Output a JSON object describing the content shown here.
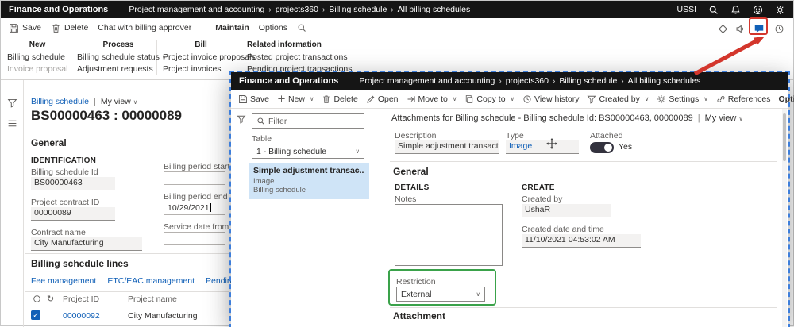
{
  "colors": {
    "accent": "#1160b7",
    "topbar_bg": "#151515",
    "annotation_red": "#d3362c",
    "annotation_green": "#3aa24a",
    "selected_bg": "#cfe4f7",
    "toggle_on": "#33323e"
  },
  "topbar": {
    "app_title": "Finance and Operations",
    "breadcrumb": [
      "Project management and accounting",
      "projects360",
      "Billing schedule",
      "All billing schedules"
    ],
    "company": "USSI"
  },
  "action_pane": {
    "save": "Save",
    "delete": "Delete",
    "chat": "Chat with billing approver",
    "maintain": "Maintain",
    "options": "Options"
  },
  "ribbon": {
    "groups": [
      {
        "title": "New",
        "items": [
          "Billing schedule",
          "Invoice proposal"
        ]
      },
      {
        "title": "Process",
        "items": [
          "Billing schedule status",
          "Adjustment requests"
        ]
      },
      {
        "title": "Bill",
        "items": [
          "Project invoice proposals",
          "Project invoices"
        ]
      },
      {
        "title": "Related information",
        "items": [
          "Posted project transactions",
          "Pending project transactions"
        ]
      }
    ]
  },
  "form": {
    "caption": "Billing schedule",
    "view": "My view",
    "title": "BS00000463 : 00000089",
    "general_header": "General",
    "identification_header": "IDENTIFICATION",
    "billing_schedule_id_label": "Billing schedule Id",
    "billing_schedule_id_value": "BS00000463",
    "project_contract_id_label": "Project contract ID",
    "project_contract_id_value": "00000089",
    "contract_name_label": "Contract name",
    "contract_name_value": "City Manufacturing",
    "billing_period_start_label": "Billing period start",
    "billing_period_start_value": "",
    "billing_period_end_label": "Billing period end",
    "billing_period_end_value": "10/29/2021",
    "service_date_from_label": "Service date from",
    "service_date_from_value": "",
    "lines_header": "Billing schedule lines",
    "tabs": [
      "Fee management",
      "ETC/EAC management",
      "Pending proj"
    ],
    "grid": {
      "col_project_id": "Project ID",
      "col_project_name": "Project name",
      "rows": [
        {
          "project_id": "00000092",
          "project_name": "City Manufacturing"
        }
      ]
    }
  },
  "dialog": {
    "app_title": "Finance and Operations",
    "breadcrumb": [
      "Project management and accounting",
      "projects360",
      "Billing schedule",
      "All billing schedules"
    ],
    "toolbar": {
      "save": "Save",
      "new": "New",
      "delete": "Delete",
      "open": "Open",
      "move_to": "Move to",
      "copy_to": "Copy to",
      "view_history": "View history",
      "created_by": "Created by",
      "settings": "Settings",
      "references": "References",
      "options": "Options"
    },
    "sidebar": {
      "filter_placeholder": "Filter",
      "table_label": "Table",
      "table_value": "1 - Billing schedule",
      "item_title": "Simple adjustment transac...",
      "item_type": "Image",
      "item_table": "Billing schedule"
    },
    "content": {
      "header": "Attachments for Billing schedule - Billing schedule Id: BS00000463, 00000089",
      "view": "My view",
      "description_label": "Description",
      "description_value": "Simple adjustment transactio...",
      "type_label": "Type",
      "type_value": "Image",
      "attached_label": "Attached",
      "attached_value": "Yes",
      "general_header": "General",
      "details_header": "DETAILS",
      "create_header": "CREATE",
      "notes_label": "Notes",
      "notes_value": "",
      "created_by_label": "Created by",
      "created_by_value": "UshaR",
      "created_datetime_label": "Created date and time",
      "created_datetime_value": "11/10/2021 04:53:02 AM",
      "restriction_label": "Restriction",
      "restriction_value": "External",
      "attachment_header": "Attachment"
    }
  }
}
